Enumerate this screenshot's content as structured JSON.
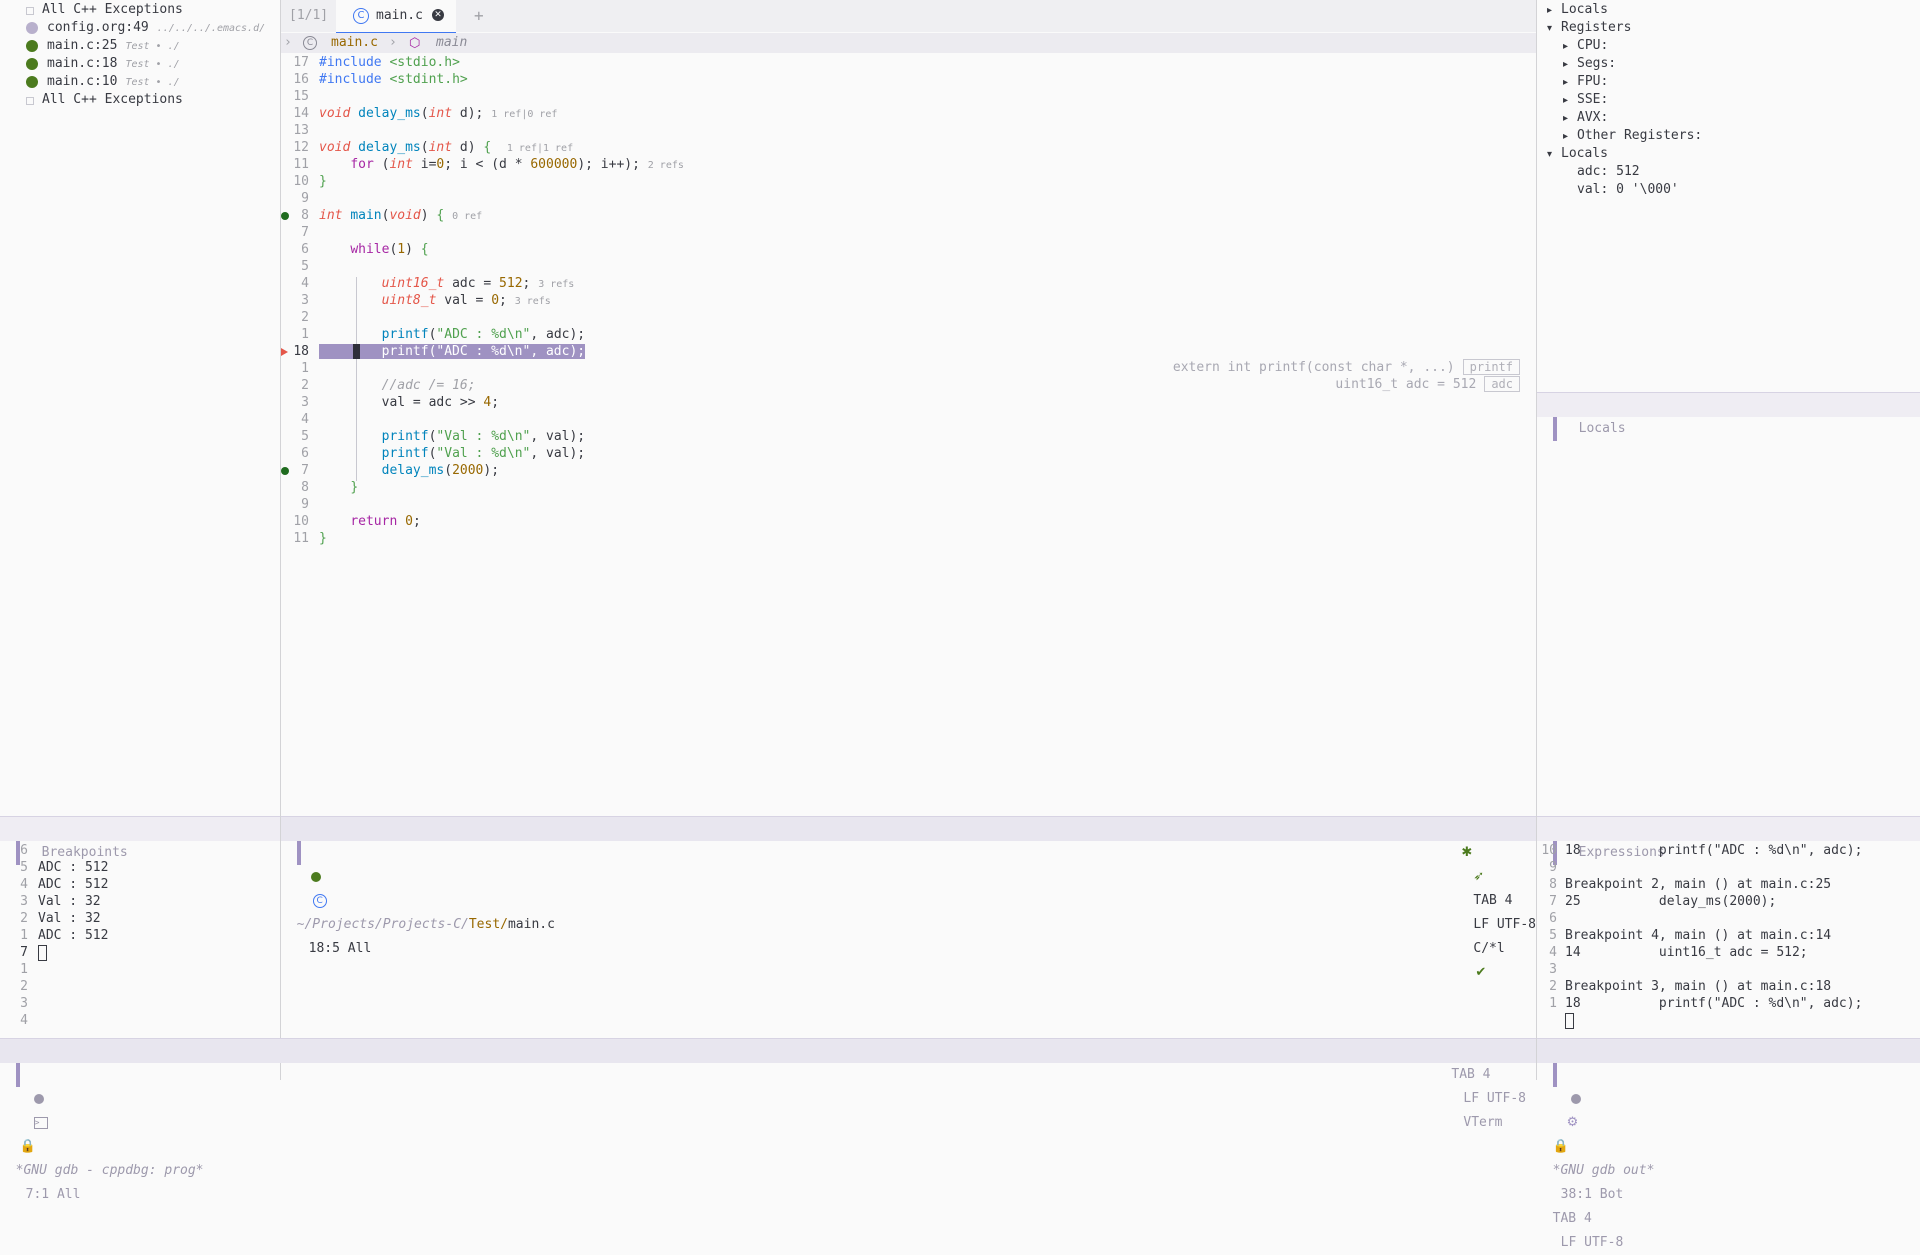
{
  "breakpoints_panel": {
    "title": "Breakpoints",
    "items": [
      {
        "label": "All C++ Exceptions",
        "meta": "",
        "dot": "#c8c8d0",
        "kind": "checkbox"
      },
      {
        "label": "config.org:49",
        "meta": "../../../.emacs.d/",
        "dot": "#b8b0cc",
        "kind": "circle"
      },
      {
        "label": "main.c:25",
        "meta": "Test • ./",
        "dot": "#4c7b1e",
        "kind": "circle"
      },
      {
        "label": "main.c:18",
        "meta": "Test • ./",
        "dot": "#4c7b1e",
        "kind": "circle"
      },
      {
        "label": "main.c:10",
        "meta": "Test • ./",
        "dot": "#4c7b1e",
        "kind": "circle"
      },
      {
        "label": "All C++ Exceptions",
        "meta": "",
        "dot": "#c8c8d0",
        "kind": "checkbox"
      }
    ]
  },
  "tabs": {
    "counter": "[1/1]",
    "active_label": "main.c",
    "add_label": "+"
  },
  "breadcrumb": {
    "arrow": "›",
    "file": "main.c",
    "symbol": "main"
  },
  "code_lines": [
    {
      "n": "17",
      "html": "<span class='pp'>#include</span> <span class='inc'>&lt;stdio.h&gt;</span>"
    },
    {
      "n": "16",
      "html": "<span class='pp'>#include</span> <span class='inc'>&lt;stdint.h&gt;</span>"
    },
    {
      "n": "15",
      "html": ""
    },
    {
      "n": "14",
      "html": "<span class='kw'>void</span> <span class='fn'>delay_ms</span>(<span class='kw'>int</span> d); <span class='lens'>1 ref|0 ref</span>"
    },
    {
      "n": "13",
      "html": ""
    },
    {
      "n": "12",
      "html": "<span class='kw'>void</span> <span class='fn'>delay_ms</span>(<span class='kw'>int</span> d) <span class='brace'>{</span>  <span class='lens'>1 ref|1 ref</span>"
    },
    {
      "n": "11",
      "html": "    <span class='kwb'>for</span> (<span class='kw'>int</span> i=<span class='num'>0</span>; i &lt; (d * <span class='num'>600000</span>); i++); <span class='lens'>2 refs</span>"
    },
    {
      "n": "10",
      "html": "<span class='brace'>}</span>"
    },
    {
      "n": "9",
      "html": ""
    },
    {
      "n": "8",
      "html": "<span class='kw'>int</span> <span class='fn'>main</span>(<span class='kw'>void</span>) <span class='brace'>{</span> <span class='lens'>0 ref</span>"
    },
    {
      "n": "7",
      "html": ""
    },
    {
      "n": "6",
      "html": "    <span class='kwb'>while</span>(<span class='num'>1</span>) <span class='brace'>{</span>"
    },
    {
      "n": "5",
      "html": ""
    },
    {
      "n": "4",
      "html": "        <span class='ty'>uint16_t</span> adc = <span class='num'>512</span>; <span class='lens'>3 refs</span>"
    },
    {
      "n": "3",
      "html": "        <span class='ty'>uint8_t</span> val = <span class='num'>0</span>; <span class='lens'>3 refs</span>"
    },
    {
      "n": "2",
      "html": ""
    },
    {
      "n": "1",
      "html": "        <span class='fn'>printf</span>(<span class='str'>\"ADC : %d\\n\"</span>, adc);"
    },
    {
      "n": "18",
      "html": "HL"
    },
    {
      "n": "1",
      "html": ""
    },
    {
      "n": "2",
      "html": "        <span class='cm'>//adc /= 16;</span>"
    },
    {
      "n": "3",
      "html": "        val = adc &gt;&gt; <span class='num'>4</span>;"
    },
    {
      "n": "4",
      "html": ""
    },
    {
      "n": "5",
      "html": "        <span class='fn'>printf</span>(<span class='str'>\"Val : %d\\n\"</span>, val);"
    },
    {
      "n": "6",
      "html": "        <span class='fn'>printf</span>(<span class='str'>\"Val : %d\\n\"</span>, val);"
    },
    {
      "n": "7",
      "html": "        <span class='fn'>delay_ms</span>(<span class='num'>2000</span>);"
    },
    {
      "n": "8",
      "html": "    <span class='brace'>}</span>"
    },
    {
      "n": "9",
      "html": ""
    },
    {
      "n": "10",
      "html": "    <span class='kwb'>return</span> <span class='num'>0</span>;"
    },
    {
      "n": "11",
      "html": "<span class='brace'>}</span>"
    }
  ],
  "current_line_text": "        printf(\"ADC : %d\\n\", adc);",
  "hover_hints": [
    {
      "text": "extern int printf(const char *, ...)",
      "tag": "printf"
    },
    {
      "text": "uint16_t adc = 512",
      "tag": "adc"
    }
  ],
  "editor_modeline": {
    "path_dim": "~/Projects/Projects-C/",
    "path_dir": "Test/",
    "path_file": "main.c",
    "position": "18:5 All",
    "tab": "TAB 4",
    "encoding": "LF UTF-8",
    "mode": "C/*l"
  },
  "locals_tree": [
    {
      "indent": 0,
      "arrow": "▸",
      "label": "Locals"
    },
    {
      "indent": 0,
      "arrow": "▾",
      "label": "Registers"
    },
    {
      "indent": 1,
      "arrow": "▸",
      "label": "CPU:"
    },
    {
      "indent": 1,
      "arrow": "▸",
      "label": "Segs:"
    },
    {
      "indent": 1,
      "arrow": "▸",
      "label": "FPU:"
    },
    {
      "indent": 1,
      "arrow": "▸",
      "label": "SSE:"
    },
    {
      "indent": 1,
      "arrow": "▸",
      "label": "AVX:"
    },
    {
      "indent": 1,
      "arrow": "▸",
      "label": "Other Registers:"
    },
    {
      "indent": 0,
      "arrow": "▾",
      "label": "Locals"
    },
    {
      "indent": 1,
      "arrow": "",
      "label": "adc: 512"
    },
    {
      "indent": 1,
      "arrow": "",
      "label": "val: 0 '\\000'"
    }
  ],
  "locals_modeline": {
    "title": "Locals"
  },
  "expressions_modeline": {
    "title": "Expressions"
  },
  "console_lines": [
    {
      "n": "6",
      "text": ""
    },
    {
      "n": "5",
      "text": "ADC : 512"
    },
    {
      "n": "4",
      "text": "ADC : 512"
    },
    {
      "n": "3",
      "text": "Val : 32"
    },
    {
      "n": "2",
      "text": "Val : 32"
    },
    {
      "n": "1",
      "text": "ADC : 512"
    },
    {
      "n": "7",
      "text": "CURSOR"
    },
    {
      "n": "1",
      "text": ""
    },
    {
      "n": "2",
      "text": ""
    },
    {
      "n": "3",
      "text": ""
    },
    {
      "n": "4",
      "text": ""
    }
  ],
  "console_modeline": {
    "buffer": "*GNU gdb - cppdbg: prog*",
    "position": "7:1 All",
    "tab": "TAB 4",
    "encoding": "LF UTF-8",
    "mode": "VTerm"
  },
  "gdb_out_lines": [
    {
      "n": "10",
      "text": "18          printf(\"ADC : %d\\n\", adc);"
    },
    {
      "n": "9",
      "text": ""
    },
    {
      "n": "8",
      "text": "Breakpoint 2, main () at main.c:25"
    },
    {
      "n": "7",
      "text": "25          delay_ms(2000);"
    },
    {
      "n": "6",
      "text": ""
    },
    {
      "n": "5",
      "text": "Breakpoint 4, main () at main.c:14"
    },
    {
      "n": "4",
      "text": "14          uint16_t adc = 512;"
    },
    {
      "n": "3",
      "text": ""
    },
    {
      "n": "2",
      "text": "Breakpoint 3, main () at main.c:18"
    },
    {
      "n": "1",
      "text": "18          printf(\"ADC : %d\\n\", adc);"
    },
    {
      "n": "",
      "text": "CURSOR"
    }
  ],
  "gdb_out_modeline": {
    "buffer": "*GNU gdb out*",
    "position": "38:1 Bot",
    "tab": "TAB 4",
    "encoding": "LF UTF-8"
  },
  "colors": {
    "breakpoint_green": "#4c7b1e",
    "current_line": "#9f92c2",
    "accent": "#4078f2"
  }
}
